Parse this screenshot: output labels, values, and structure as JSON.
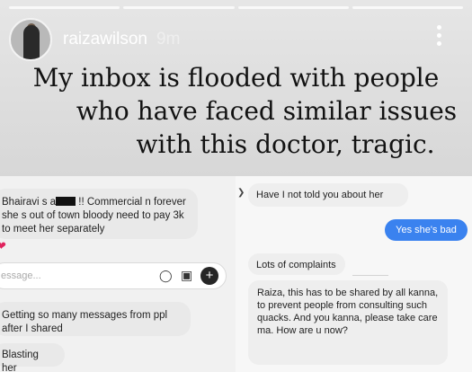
{
  "story": {
    "username": "raizawilson",
    "time": "9m",
    "caption": [
      "My inbox is flooded with people",
      "who have faced similar issues",
      "with this doctor, tragic."
    ]
  },
  "left_chat": {
    "message1_part1": "Bhairavi s a",
    "message1_part2": " !! Commercial n forever she s out of town bloody need to pay 3k to meet her separately",
    "reaction": "❤",
    "composer_placeholder": "essage...",
    "message2": "Getting so many messages from ppl after I shared",
    "message3": "Blasting her"
  },
  "right_chat": {
    "message1": "Have I not told you about her",
    "sent_message": "Yes she's bad",
    "message2": "Lots of complaints",
    "message3": "Raiza, this has to be shared by all kanna, to prevent people from consulting such quacks. And you kanna, please take care ma. How are u now?"
  },
  "icons": {
    "menu": "more-vertical-icon",
    "mic": "mic-icon",
    "gallery": "gallery-icon",
    "plus": "plus-icon",
    "chevron": "chevron-icon"
  },
  "colors": {
    "sent_bubble": "#3a82ef",
    "received_bubble": "#e9e9e9",
    "heart": "#e0245e"
  }
}
